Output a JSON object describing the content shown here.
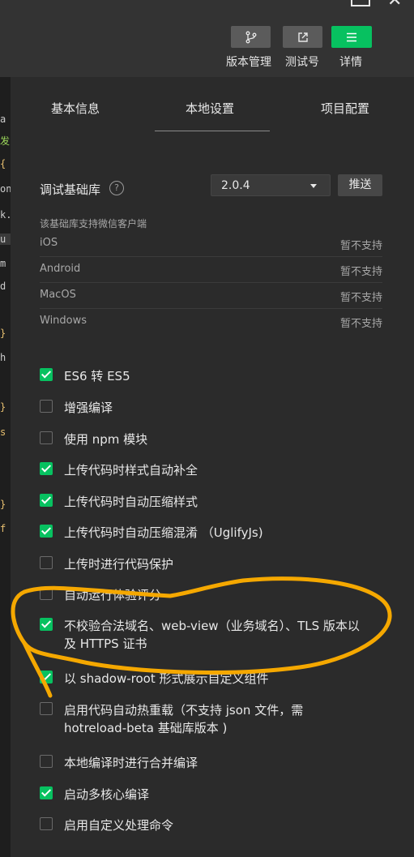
{
  "toolbar": {
    "version_label": "版本管理",
    "test_label": "测试号",
    "detail_label": "详情"
  },
  "tabs": [
    "基本信息",
    "本地设置",
    "项目配置"
  ],
  "library": {
    "label": "调试基础库",
    "help": "?",
    "version": "2.0.4",
    "push_label": "推送",
    "note": "该基础库支持微信客户端",
    "platforms": [
      {
        "name": "iOS",
        "status": "暂不支持"
      },
      {
        "name": "Android",
        "status": "暂不支持"
      },
      {
        "name": "MacOS",
        "status": "暂不支持"
      },
      {
        "name": "Windows",
        "status": "暂不支持"
      }
    ]
  },
  "options": [
    {
      "label": "ES6 转 ES5",
      "checked": true
    },
    {
      "label": "增强编译",
      "checked": false
    },
    {
      "label": "使用 npm 模块",
      "checked": false
    },
    {
      "label": "上传代码时样式自动补全",
      "checked": true
    },
    {
      "label": "上传代码时自动压缩样式",
      "checked": true
    },
    {
      "label": "上传代码时自动压缩混淆 （UglifyJs)",
      "checked": true
    },
    {
      "label": "上传时进行代码保护",
      "checked": false
    },
    {
      "label": "自动运行体验评分",
      "checked": false
    },
    {
      "label": "不校验合法域名、web-view（业务域名）、TLS 版本以及 HTTPS 证书",
      "checked": true
    },
    {
      "label": "以 shadow-root 形式展示自定义组件",
      "checked": true
    },
    {
      "label": "启用代码自动热重载（不支持 json 文件，需 hotreload-beta 基础库版本 )",
      "checked": false
    },
    {
      "label": "本地编译时进行合并编译",
      "checked": false
    },
    {
      "label": "启动多核心编译",
      "checked": true
    },
    {
      "label": "启用自定义处理命令",
      "checked": false
    }
  ],
  "colors": {
    "accent": "#07c160",
    "annotation": "#f5a800"
  }
}
